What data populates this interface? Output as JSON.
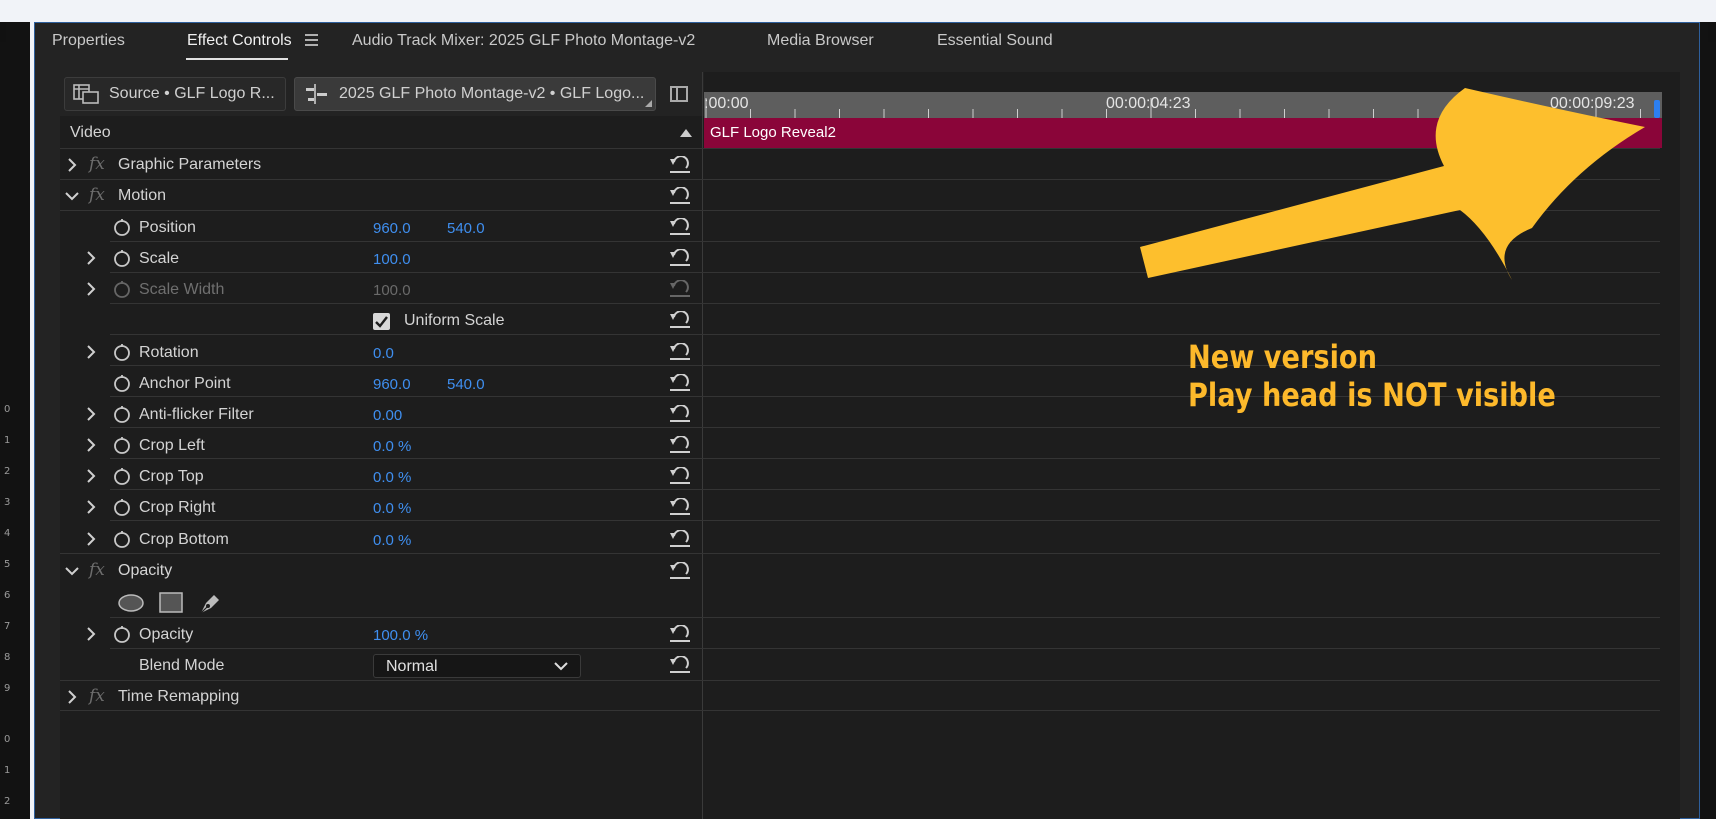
{
  "tabs": {
    "properties": "Properties",
    "effect_controls": "Effect Controls",
    "audio_mixer": "Audio Track Mixer: 2025 GLF Photo Montage-v2",
    "media_browser": "Media Browser",
    "essential_sound": "Essential Sound"
  },
  "source_tabs": {
    "source": "Source • GLF Logo R...",
    "sequence": "2025 GLF Photo Montage-v2 • GLF Logo..."
  },
  "section": {
    "video": "Video"
  },
  "timeline": {
    "tc_start": ":00:00",
    "tc_mid": "00:00:04:23",
    "tc_end": "00:00:09:23",
    "clip_name": "GLF Logo Reveal2",
    "clip_color": "#8a0539"
  },
  "left_strip_numbers": [
    "0",
    "1",
    "2",
    "3",
    "4",
    "5",
    "6",
    "7",
    "8",
    "9",
    "0",
    "1",
    "2"
  ],
  "effects": {
    "graphic_parameters": "Graphic Parameters",
    "motion": "Motion",
    "position": {
      "label": "Position",
      "x": "960.0",
      "y": "540.0"
    },
    "scale": {
      "label": "Scale",
      "value": "100.0"
    },
    "scale_width": {
      "label": "Scale Width",
      "value": "100.0"
    },
    "uniform_scale": {
      "label": "Uniform Scale",
      "checked": true
    },
    "rotation": {
      "label": "Rotation",
      "value": "0.0"
    },
    "anchor_point": {
      "label": "Anchor Point",
      "x": "960.0",
      "y": "540.0"
    },
    "anti_flicker": {
      "label": "Anti-flicker Filter",
      "value": "0.00"
    },
    "crop_left": {
      "label": "Crop Left",
      "value": "0.0 %"
    },
    "crop_top": {
      "label": "Crop Top",
      "value": "0.0 %"
    },
    "crop_right": {
      "label": "Crop Right",
      "value": "0.0 %"
    },
    "crop_bottom": {
      "label": "Crop Bottom",
      "value": "0.0 %"
    },
    "opacity_group": "Opacity",
    "opacity": {
      "label": "Opacity",
      "value": "100.0 %"
    },
    "blend_mode": {
      "label": "Blend Mode",
      "value": "Normal"
    },
    "time_remapping": "Time Remapping"
  },
  "annotation": {
    "line1": "New version",
    "line2": "Play head is NOT visible",
    "color": "#fdb92b"
  },
  "colors": {
    "value_blue": "#3f8ff0",
    "panel_border": "#2e5f9c"
  }
}
